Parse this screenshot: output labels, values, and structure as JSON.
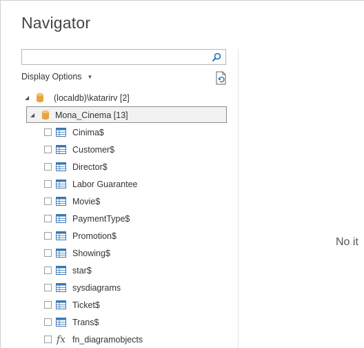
{
  "window": {
    "title": "Navigator"
  },
  "search": {
    "placeholder": "",
    "value": ""
  },
  "display_options": {
    "label": "Display Options"
  },
  "tree": {
    "server": {
      "label": "(localdb)\\katarirv [2]"
    },
    "database": {
      "label": "Mona_Cinema [13]"
    },
    "items": [
      {
        "label": "Cinima$",
        "icon": "table-icon"
      },
      {
        "label": "Customer$",
        "icon": "table-icon"
      },
      {
        "label": "Director$",
        "icon": "table-icon"
      },
      {
        "label": "Labor Guarantee",
        "icon": "table-icon"
      },
      {
        "label": "Movie$",
        "icon": "table-icon"
      },
      {
        "label": "PaymentType$",
        "icon": "table-icon"
      },
      {
        "label": "Promotion$",
        "icon": "table-icon"
      },
      {
        "label": "Showing$",
        "icon": "table-icon"
      },
      {
        "label": "star$",
        "icon": "table-icon"
      },
      {
        "label": "sysdiagrams",
        "icon": "table-icon"
      },
      {
        "label": "Ticket$",
        "icon": "table-icon"
      },
      {
        "label": "Trans$",
        "icon": "table-icon"
      },
      {
        "label": "fn_diagramobjects",
        "icon": "function-icon",
        "glyph": "fx"
      }
    ]
  },
  "preview": {
    "empty_text": "No it"
  },
  "colors": {
    "accent": "#1e6fb8",
    "db_icon": "#e8a33d",
    "table_icon": "#3a78b7"
  }
}
